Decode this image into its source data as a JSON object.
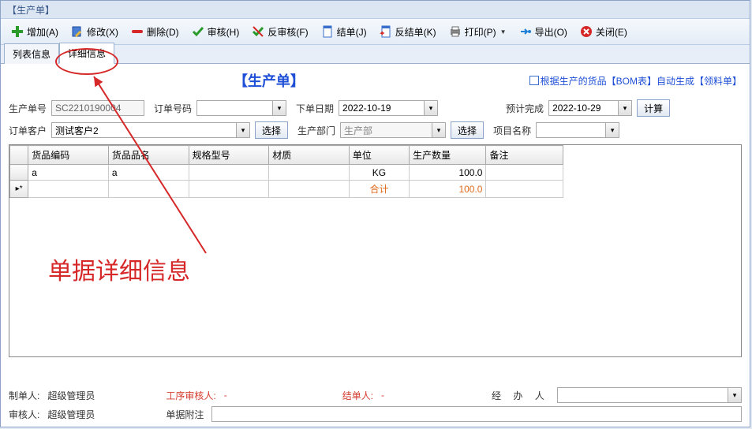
{
  "window": {
    "title": "【生产单】"
  },
  "toolbar": {
    "add": "增加(A)",
    "edit": "修改(X)",
    "delete": "删除(D)",
    "audit": "审核(H)",
    "unaudit": "反审核(F)",
    "close_doc": "结单(J)",
    "unclose_doc": "反结单(K)",
    "print": "打印(P)",
    "export": "导出(O)",
    "close": "关闭(E)"
  },
  "tabs": {
    "list": "列表信息",
    "detail": "详细信息"
  },
  "header": {
    "doc_title": "【生产单】",
    "auto_gen": "根据生产的货品【BOM表】自动生成【领料单】"
  },
  "form": {
    "order_no_lbl": "生产单号",
    "order_no": "SC2210190004",
    "ref_no_lbl": "订单号码",
    "ref_no": "",
    "order_date_lbl": "下单日期",
    "order_date": "2022-10-19",
    "due_date_lbl": "预计完成",
    "due_date": "2022-10-29",
    "calc_btn": "计算",
    "customer_lbl": "订单客户",
    "customer": "测试客户2",
    "select_btn": "选择",
    "dept_lbl": "生产部门",
    "dept": "生产部",
    "project_lbl": "项目名称",
    "project": ""
  },
  "grid": {
    "cols": {
      "code": "货品编码",
      "name": "货品品名",
      "spec": "规格型号",
      "material": "材质",
      "unit": "单位",
      "qty": "生产数量",
      "remark": "备注"
    },
    "rows": [
      {
        "code": "a",
        "name": "a",
        "spec": "",
        "material": "",
        "unit": "KG",
        "qty": "100.0",
        "remark": ""
      }
    ],
    "sum_label": "合计",
    "sum_qty": "100.0",
    "row_marker": "▸*"
  },
  "footer": {
    "creator_lbl": "制单人:",
    "creator": "超级管理员",
    "process_auditor_lbl": "工序审核人:",
    "process_auditor": "-",
    "closer_lbl": "结单人:",
    "closer": "-",
    "handler_lbl": "经 办 人",
    "handler": "",
    "auditor_lbl": "审核人:",
    "auditor": "超级管理员",
    "attach_lbl": "单据附注",
    "attach": ""
  },
  "annotation": {
    "text": "单据详细信息"
  }
}
